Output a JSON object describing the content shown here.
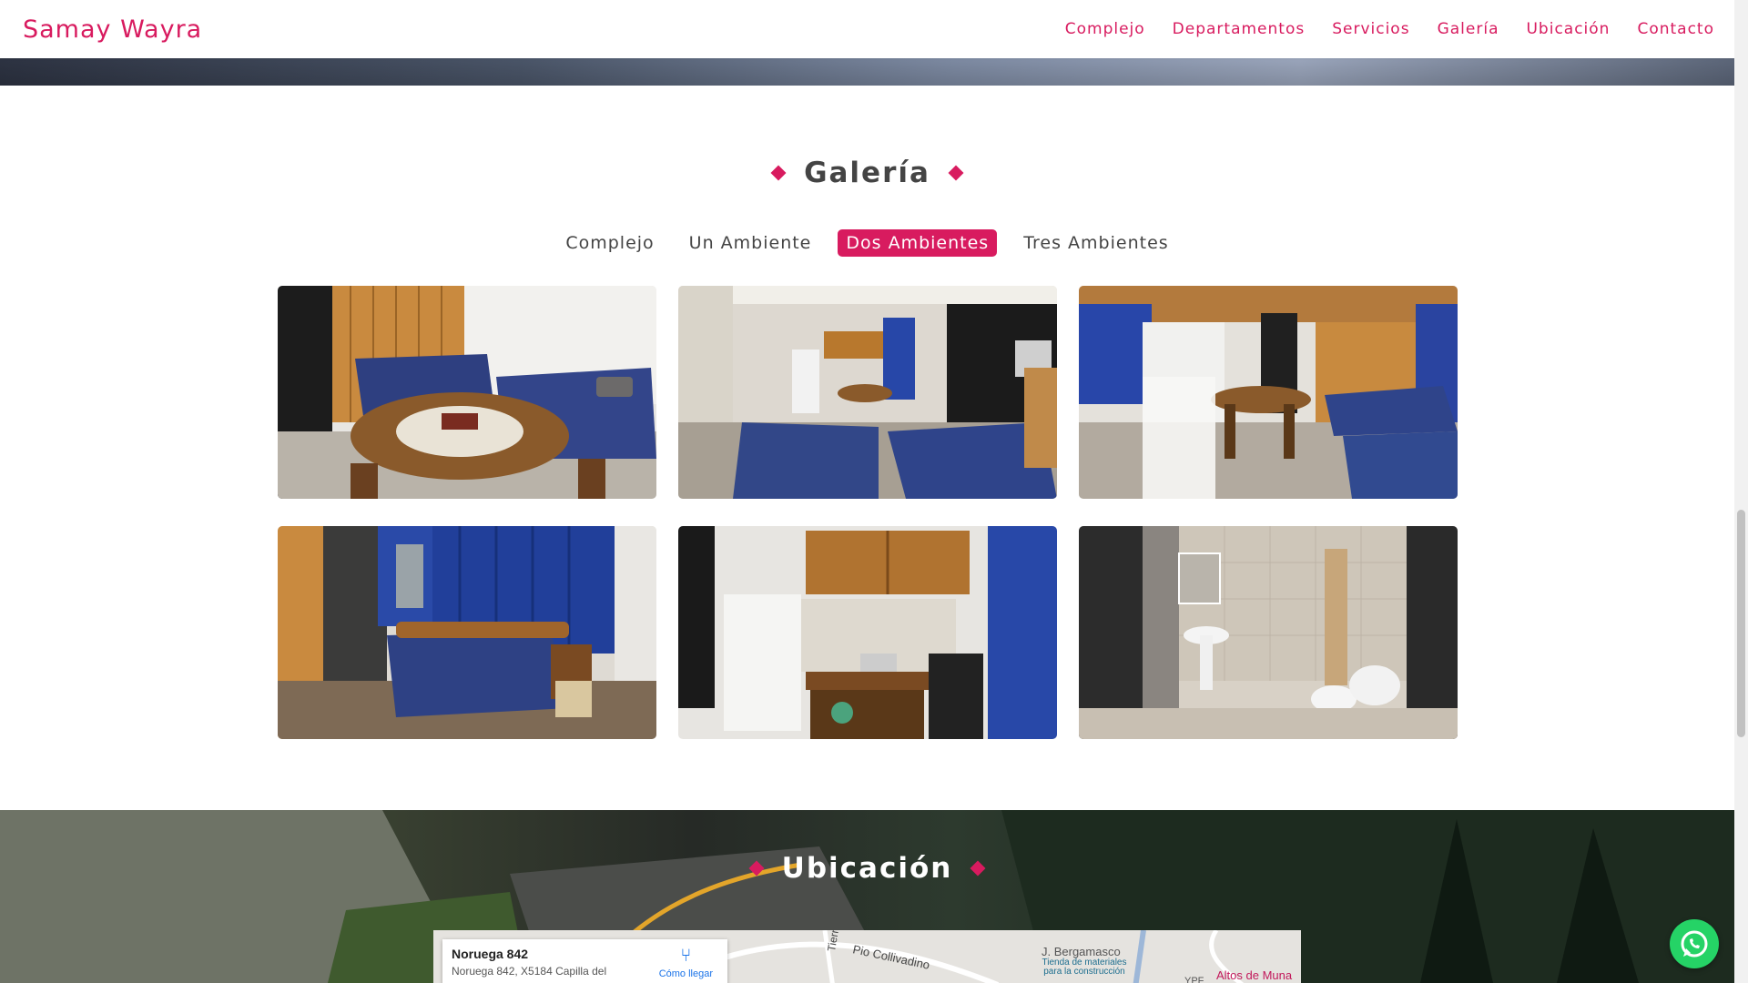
{
  "brand": "Samay Wayra",
  "nav": [
    "Complejo",
    "Departamentos",
    "Servicios",
    "Galería",
    "Ubicación",
    "Contacto"
  ],
  "gallery": {
    "title": "Galería",
    "filters": [
      "Complejo",
      "Un Ambiente",
      "Dos Ambientes",
      "Tres Ambientes"
    ],
    "active_filter": "Dos Ambientes",
    "photos": [
      "bedroom-dining-photo",
      "living-kitchen-photo",
      "dining-room-photo",
      "double-bedroom-photo",
      "kitchenette-photo",
      "bathroom-photo"
    ]
  },
  "location": {
    "title": "Ubicación",
    "map": {
      "place_name": "Noruega 842",
      "address": "Noruega 842, X5184 Capilla del",
      "directions_label": "Cómo llegar",
      "street_1": "Pio Collivadino",
      "street_2": "Tierra de",
      "store_name": "J. Bergamasco",
      "store_type": "Tienda de materiales para la construcción",
      "area_label": "Altos de Muna",
      "fuel_label": "YPF"
    }
  },
  "colors": {
    "accent": "#d81b5f",
    "whatsapp": "#25d366",
    "map_link": "#1a73e8"
  },
  "icons": [
    "whatsapp-icon",
    "directions-icon",
    "diamond-icon"
  ]
}
